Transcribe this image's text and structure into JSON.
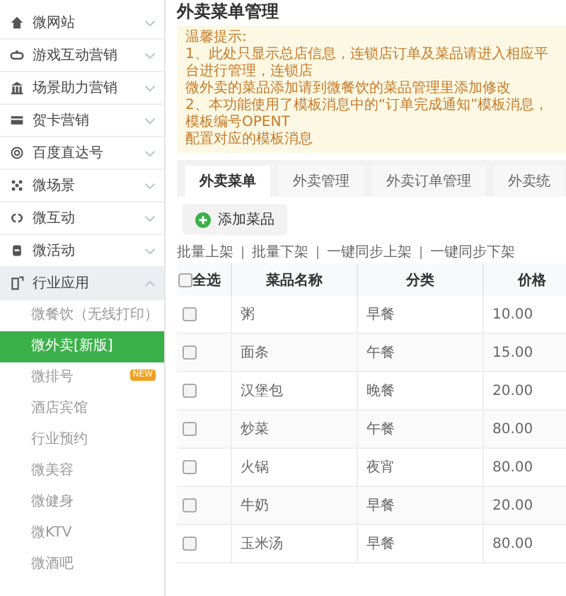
{
  "sidebar": {
    "items": [
      {
        "label": "微网站",
        "expanded": false
      },
      {
        "label": "游戏互动营销",
        "expanded": false
      },
      {
        "label": "场景助力营销",
        "expanded": false
      },
      {
        "label": "贺卡营销",
        "expanded": false
      },
      {
        "label": "百度直达号",
        "expanded": false
      },
      {
        "label": "微场景",
        "expanded": false
      },
      {
        "label": "微互动",
        "expanded": false
      },
      {
        "label": "微活动",
        "expanded": false
      },
      {
        "label": "行业应用",
        "expanded": true,
        "children": [
          {
            "label": "微餐饮（无线打印）",
            "selected": false
          },
          {
            "label": "微外卖[新版]",
            "selected": true
          },
          {
            "label": "微排号",
            "selected": false,
            "badge": "NEW"
          },
          {
            "label": "酒店宾馆",
            "selected": false
          },
          {
            "label": "行业预约",
            "selected": false
          },
          {
            "label": "微美容",
            "selected": false
          },
          {
            "label": "微健身",
            "selected": false
          },
          {
            "label": "微KTV",
            "selected": false
          },
          {
            "label": "微酒吧",
            "selected": false
          }
        ]
      }
    ]
  },
  "page_title": "外卖菜单管理",
  "notice": {
    "heading": "温馨提示:",
    "lines": [
      "1、此处只显示总店信息，连锁店订单及菜品请进入相应平台进行管理，连锁店",
      "微外卖的菜品添加请到微餐饮的菜品管理里添加修改",
      "2、本功能使用了模板消息中的“订单完成通知”模板消息，模板编号OPENT",
      "配置对应的模板消息"
    ]
  },
  "tabs": [
    {
      "label": "外卖菜单",
      "selected": true
    },
    {
      "label": "外卖管理",
      "selected": false
    },
    {
      "label": "外卖订单管理",
      "selected": false
    },
    {
      "label": "外卖统",
      "selected": false
    }
  ],
  "add_button": "添加菜品",
  "batch_actions": [
    "批量上架",
    "批量下架",
    "一键同步上架",
    "一键同步下架"
  ],
  "table": {
    "select_all": {
      "label": "全选",
      "checked": false
    },
    "columns": [
      "菜品名称",
      "分类",
      "价格"
    ],
    "rows": [
      {
        "checked": false,
        "cells": [
          "粥",
          "早餐",
          "10.00"
        ]
      },
      {
        "checked": false,
        "cells": [
          "面条",
          "午餐",
          "15.00"
        ]
      },
      {
        "checked": false,
        "cells": [
          "汉堡包",
          "晚餐",
          "20.00"
        ]
      },
      {
        "checked": false,
        "cells": [
          "炒菜",
          "午餐",
          "80.00"
        ]
      },
      {
        "checked": false,
        "cells": [
          "火锅",
          "夜宵",
          "80.00"
        ]
      },
      {
        "checked": false,
        "cells": [
          "牛奶",
          "早餐",
          "20.00"
        ]
      },
      {
        "checked": false,
        "cells": [
          "玉米汤",
          "早餐",
          "80.00"
        ]
      }
    ]
  }
}
